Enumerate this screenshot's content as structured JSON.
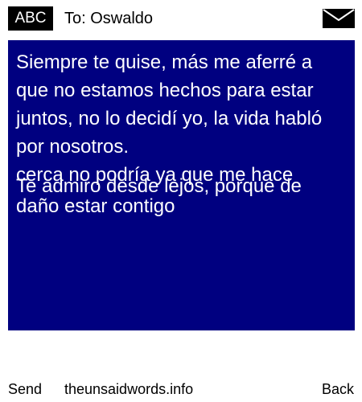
{
  "header": {
    "mode": "ABC",
    "recipient": "To: Oswaldo",
    "icon": "envelope-icon"
  },
  "message": {
    "text": "Siempre te quise, más me aferré a que no estamos hechos para estar juntos, no lo decidí yo, la vida habló por nosotros.\ncerca no podría ya que me hace",
    "overlap_text": "Te admiro desde lejos, porque de daño estar contigo"
  },
  "footer": {
    "left_softkey": "Send",
    "site": "theunsaidwords.info",
    "right_softkey": "Back"
  },
  "colors": {
    "message_background": "#000080",
    "message_text": "#ffffff",
    "badge_background": "#000000"
  }
}
